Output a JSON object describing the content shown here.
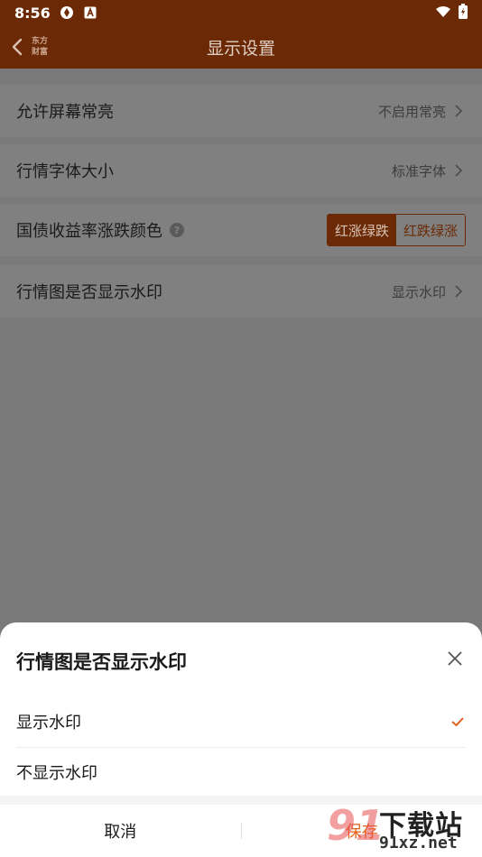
{
  "status_bar": {
    "time": "8:56",
    "icons": [
      "sync-icon",
      "a-icon",
      "wifi-icon",
      "battery-icon"
    ]
  },
  "header": {
    "back_icon": "chevron-left-icon",
    "logo_text": "东方财富",
    "title": "显示设置"
  },
  "settings": [
    {
      "label": "允许屏幕常亮",
      "value": "不启用常亮"
    },
    {
      "label": "行情字体大小",
      "value": "标准字体"
    },
    {
      "label": "国债收益率涨跌颜色",
      "options": [
        "红涨绿跌",
        "红跌绿涨"
      ],
      "selected": "红涨绿跌"
    },
    {
      "label": "行情图是否显示水印",
      "value": "显示水印"
    }
  ],
  "sheet": {
    "title": "行情图是否显示水印",
    "options": [
      {
        "label": "显示水印",
        "selected": true
      },
      {
        "label": "不显示水印",
        "selected": false
      }
    ],
    "cancel_label": "取消",
    "save_label": "保存"
  },
  "watermark": {
    "number": "91",
    "text": "下载站",
    "url": "91xz.net"
  },
  "colors": {
    "header_bg": "#6b2a05",
    "accent": "#e6611a",
    "overlay": "#7a7a7a"
  }
}
